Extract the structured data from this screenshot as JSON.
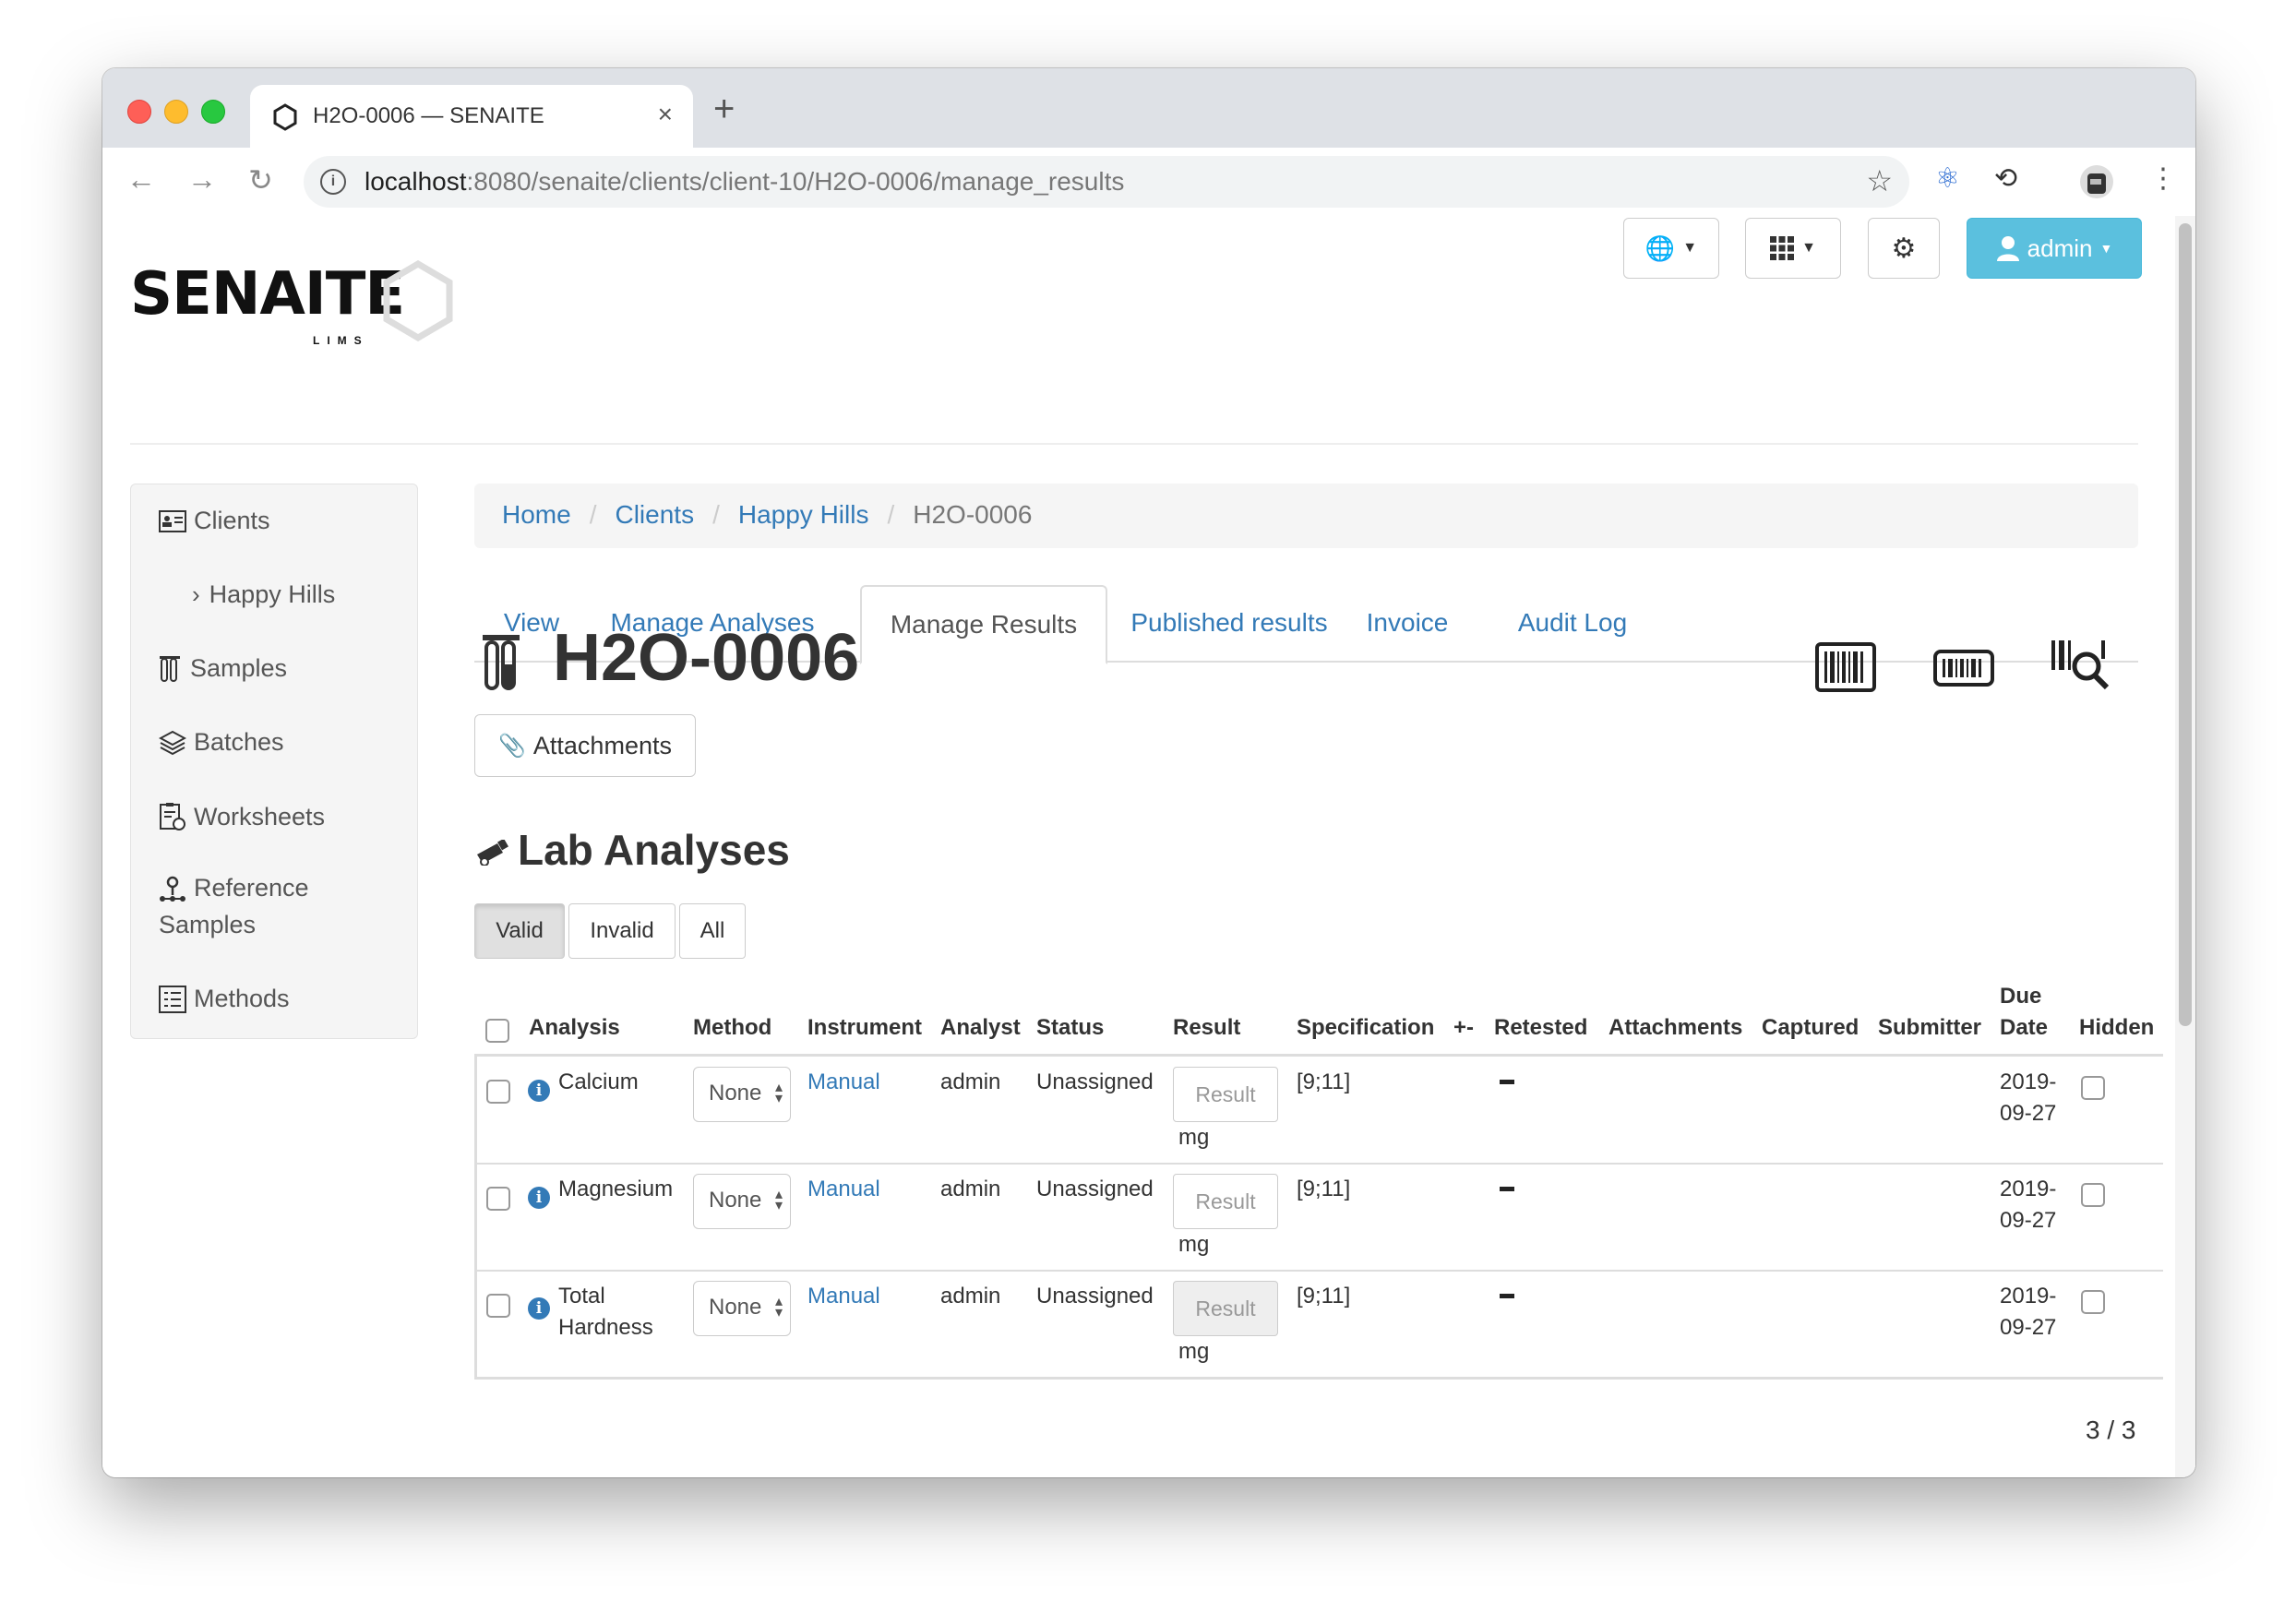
{
  "browser": {
    "tab_title": "H2O-0006 — SENAITE",
    "url_host": "localhost",
    "url_path": ":8080/senaite/clients/client-10/H2O-0006/manage_results"
  },
  "logo": {
    "text": "SENAITE",
    "sub": "LIMS"
  },
  "topnav": {
    "admin_label": "admin"
  },
  "sidebar": {
    "items": [
      {
        "label": "Clients",
        "icon": "clients-card-icon"
      },
      {
        "label": "Happy Hills",
        "icon": "chevron-right-icon"
      },
      {
        "label": "Samples",
        "icon": "sample-tubes-icon"
      },
      {
        "label": "Batches",
        "icon": "layers-icon"
      },
      {
        "label": "Worksheets",
        "icon": "worksheet-icon"
      },
      {
        "label": "Reference",
        "label2": "Samples",
        "icon": "reference-icon"
      },
      {
        "label": "Methods",
        "icon": "methods-list-icon"
      }
    ]
  },
  "breadcrumb": [
    {
      "label": "Home"
    },
    {
      "label": "Clients"
    },
    {
      "label": "Happy Hills"
    },
    {
      "label": "H2O-0006"
    }
  ],
  "tabs": [
    {
      "label": "View"
    },
    {
      "label": "Manage Analyses"
    },
    {
      "label": "Manage Results",
      "active": true
    },
    {
      "label": "Published results"
    },
    {
      "label": "Invoice"
    },
    {
      "label": "Audit Log"
    }
  ],
  "sample": {
    "id": "H2O-0006",
    "attachments_label": "Attachments"
  },
  "lab_analyses": {
    "title": "Lab Analyses",
    "filters": [
      {
        "label": "Valid",
        "active": true
      },
      {
        "label": "Invalid"
      },
      {
        "label": "All"
      }
    ],
    "columns": {
      "analysis": "Analysis",
      "method": "Method",
      "instrument": "Instrument",
      "analyst": "Analyst",
      "status": "Status",
      "result": "Result",
      "specification": "Specification",
      "plusminus": "+-",
      "retested": "Retested",
      "attachments": "Attachments",
      "captured": "Captured",
      "submitter": "Submitter",
      "due_date_1": "Due",
      "due_date_2": "Date",
      "hidden": "Hidden"
    },
    "rows": [
      {
        "analysis": "Calcium",
        "analysis2": "",
        "method": "None",
        "instrument": "Manual",
        "analyst": "admin",
        "status": "Unassigned",
        "result_placeholder": "Result",
        "unit": "mg",
        "specification": "[9;11]",
        "due_1": "2019-",
        "due_2": "09-27"
      },
      {
        "analysis": "Magnesium",
        "analysis2": "",
        "method": "None",
        "instrument": "Manual",
        "analyst": "admin",
        "status": "Unassigned",
        "result_placeholder": "Result",
        "unit": "mg",
        "specification": "[9;11]",
        "due_1": "2019-",
        "due_2": "09-27"
      },
      {
        "analysis": "Total",
        "analysis2": "Hardness",
        "method": "None",
        "instrument": "Manual",
        "analyst": "admin",
        "status": "Unassigned",
        "result_placeholder": "Result",
        "unit": "mg",
        "specification": "[9;11]",
        "due_1": "2019-",
        "due_2": "09-27"
      }
    ],
    "pager": "3 / 3"
  },
  "colors": {
    "link": "#337ab7",
    "admin_button": "#5bc0de"
  }
}
